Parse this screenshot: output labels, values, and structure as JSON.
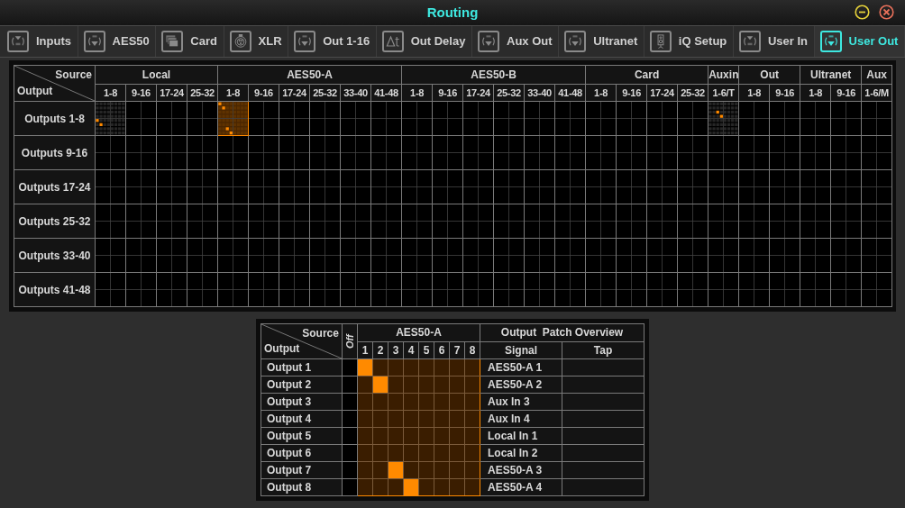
{
  "window": {
    "title": "Routing"
  },
  "tabs": [
    {
      "label": "Inputs",
      "kind": "in",
      "selected": false
    },
    {
      "label": "AES50",
      "kind": "out",
      "selected": false
    },
    {
      "label": "Card",
      "kind": "card",
      "selected": false
    },
    {
      "label": "XLR",
      "kind": "xlr",
      "selected": false
    },
    {
      "label": "Out 1-16",
      "kind": "out",
      "selected": false
    },
    {
      "label": "Out Delay",
      "kind": "delay",
      "selected": false
    },
    {
      "label": "Aux Out",
      "kind": "out",
      "selected": false
    },
    {
      "label": "Ultranet",
      "kind": "out",
      "selected": false
    },
    {
      "label": "iQ Setup",
      "kind": "speaker",
      "selected": false
    },
    {
      "label": "User In",
      "kind": "in",
      "selected": false
    },
    {
      "label": "User Out",
      "kind": "out",
      "selected": true
    }
  ],
  "overview": {
    "source_label": "Source",
    "output_label": "Output",
    "groups": [
      {
        "label": "Local",
        "blocks": [
          "1-8",
          "9-16",
          "17-24",
          "25-32"
        ]
      },
      {
        "label": "AES50-A",
        "blocks": [
          "1-8",
          "9-16",
          "17-24",
          "25-32",
          "33-40",
          "41-48"
        ]
      },
      {
        "label": "AES50-B",
        "blocks": [
          "1-8",
          "9-16",
          "17-24",
          "25-32",
          "33-40",
          "41-48"
        ]
      },
      {
        "label": "Card",
        "blocks": [
          "1-8",
          "9-16",
          "17-24",
          "25-32"
        ]
      },
      {
        "label": "Auxin",
        "blocks": [
          "1-6/T"
        ]
      },
      {
        "label": "Out",
        "blocks": [
          "1-8",
          "9-16"
        ]
      },
      {
        "label": "Ultranet",
        "blocks": [
          "1-8",
          "9-16"
        ]
      },
      {
        "label": "Aux",
        "blocks": [
          "1-6/M"
        ]
      }
    ],
    "rows": [
      {
        "label": "Outputs 1-8",
        "blocks": [
          {
            "selected": false,
            "dots": [
              [
                false,
                false,
                false,
                false,
                false,
                false,
                false,
                false
              ],
              [
                false,
                false,
                false,
                false,
                false,
                false,
                false,
                false
              ],
              [
                false,
                false,
                false,
                false,
                false,
                false,
                false,
                false
              ],
              [
                false,
                false,
                false,
                false,
                false,
                false,
                false,
                false
              ],
              [
                true,
                false,
                false,
                false,
                false,
                false,
                false,
                false
              ],
              [
                false,
                true,
                false,
                false,
                false,
                false,
                false,
                false
              ],
              [
                false,
                false,
                false,
                false,
                false,
                false,
                false,
                false
              ],
              [
                false,
                false,
                false,
                false,
                false,
                false,
                false,
                false
              ]
            ]
          },
          {
            "selected": false
          },
          {
            "selected": false
          },
          {
            "selected": false
          },
          {
            "selected": true,
            "dots": [
              [
                true,
                false,
                false,
                false,
                false,
                false,
                false,
                false
              ],
              [
                false,
                true,
                false,
                false,
                false,
                false,
                false,
                false
              ],
              [
                false,
                false,
                false,
                false,
                false,
                false,
                false,
                false
              ],
              [
                false,
                false,
                false,
                false,
                false,
                false,
                false,
                false
              ],
              [
                false,
                false,
                false,
                false,
                false,
                false,
                false,
                false
              ],
              [
                false,
                false,
                false,
                false,
                false,
                false,
                false,
                false
              ],
              [
                false,
                false,
                true,
                false,
                false,
                false,
                false,
                false
              ],
              [
                false,
                false,
                false,
                true,
                false,
                false,
                false,
                false
              ]
            ]
          },
          {
            "selected": false
          },
          {
            "selected": false
          },
          {
            "selected": false
          },
          {
            "selected": false
          },
          {
            "selected": false
          },
          {
            "selected": false
          },
          {
            "selected": false
          },
          {
            "selected": false
          },
          {
            "selected": false
          },
          {
            "selected": false
          },
          {
            "selected": false
          },
          {
            "selected": false
          },
          {
            "selected": false
          },
          {
            "selected": false
          },
          {
            "selected": false
          },
          {
            "selected": false,
            "dots": [
              [
                false,
                false,
                false,
                false,
                false,
                false,
                false,
                false
              ],
              [
                false,
                false,
                false,
                false,
                false,
                false,
                false,
                false
              ],
              [
                false,
                false,
                true,
                false,
                false,
                false,
                false,
                false
              ],
              [
                false,
                false,
                false,
                true,
                false,
                false,
                false,
                false
              ],
              [
                false,
                false,
                false,
                false,
                false,
                false,
                false,
                false
              ],
              [
                false,
                false,
                false,
                false,
                false,
                false,
                false,
                false
              ],
              [
                false,
                false,
                false,
                false,
                false,
                false,
                false,
                false
              ],
              [
                false,
                false,
                false,
                false,
                false,
                false,
                false,
                false
              ]
            ]
          },
          {
            "selected": false
          },
          {
            "selected": false
          },
          {
            "selected": false
          },
          {
            "selected": false
          },
          {
            "selected": false
          }
        ]
      },
      {
        "label": "Outputs 9-16",
        "blocks": [
          {
            "selected": false
          },
          {
            "selected": false
          },
          {
            "selected": false
          },
          {
            "selected": false
          },
          {
            "selected": false
          },
          {
            "selected": false
          },
          {
            "selected": false
          },
          {
            "selected": false
          },
          {
            "selected": false
          },
          {
            "selected": false
          },
          {
            "selected": false
          },
          {
            "selected": false
          },
          {
            "selected": false
          },
          {
            "selected": false
          },
          {
            "selected": false
          },
          {
            "selected": false
          },
          {
            "selected": false
          },
          {
            "selected": false
          },
          {
            "selected": false
          },
          {
            "selected": false
          },
          {
            "selected": false
          },
          {
            "selected": false
          },
          {
            "selected": false
          },
          {
            "selected": false
          },
          {
            "selected": false
          },
          {
            "selected": false
          }
        ]
      },
      {
        "label": "Outputs 17-24",
        "blocks": [
          {
            "selected": false
          },
          {
            "selected": false
          },
          {
            "selected": false
          },
          {
            "selected": false
          },
          {
            "selected": false
          },
          {
            "selected": false
          },
          {
            "selected": false
          },
          {
            "selected": false
          },
          {
            "selected": false
          },
          {
            "selected": false
          },
          {
            "selected": false
          },
          {
            "selected": false
          },
          {
            "selected": false
          },
          {
            "selected": false
          },
          {
            "selected": false
          },
          {
            "selected": false
          },
          {
            "selected": false
          },
          {
            "selected": false
          },
          {
            "selected": false
          },
          {
            "selected": false
          },
          {
            "selected": false
          },
          {
            "selected": false
          },
          {
            "selected": false
          },
          {
            "selected": false
          },
          {
            "selected": false
          },
          {
            "selected": false
          }
        ]
      },
      {
        "label": "Outputs 25-32",
        "blocks": [
          {
            "selected": false
          },
          {
            "selected": false
          },
          {
            "selected": false
          },
          {
            "selected": false
          },
          {
            "selected": false
          },
          {
            "selected": false
          },
          {
            "selected": false
          },
          {
            "selected": false
          },
          {
            "selected": false
          },
          {
            "selected": false
          },
          {
            "selected": false
          },
          {
            "selected": false
          },
          {
            "selected": false
          },
          {
            "selected": false
          },
          {
            "selected": false
          },
          {
            "selected": false
          },
          {
            "selected": false
          },
          {
            "selected": false
          },
          {
            "selected": false
          },
          {
            "selected": false
          },
          {
            "selected": false
          },
          {
            "selected": false
          },
          {
            "selected": false
          },
          {
            "selected": false
          },
          {
            "selected": false
          },
          {
            "selected": false
          }
        ]
      },
      {
        "label": "Outputs 33-40",
        "blocks": [
          {
            "selected": false
          },
          {
            "selected": false
          },
          {
            "selected": false
          },
          {
            "selected": false
          },
          {
            "selected": false
          },
          {
            "selected": false
          },
          {
            "selected": false
          },
          {
            "selected": false
          },
          {
            "selected": false
          },
          {
            "selected": false
          },
          {
            "selected": false
          },
          {
            "selected": false
          },
          {
            "selected": false
          },
          {
            "selected": false
          },
          {
            "selected": false
          },
          {
            "selected": false
          },
          {
            "selected": false
          },
          {
            "selected": false
          },
          {
            "selected": false
          },
          {
            "selected": false
          },
          {
            "selected": false
          },
          {
            "selected": false
          },
          {
            "selected": false
          },
          {
            "selected": false
          },
          {
            "selected": false
          },
          {
            "selected": false
          }
        ]
      },
      {
        "label": "Outputs 41-48",
        "blocks": [
          {
            "selected": false
          },
          {
            "selected": false
          },
          {
            "selected": false
          },
          {
            "selected": false
          },
          {
            "selected": false
          },
          {
            "selected": false
          },
          {
            "selected": false
          },
          {
            "selected": false
          },
          {
            "selected": false
          },
          {
            "selected": false
          },
          {
            "selected": false
          },
          {
            "selected": false
          },
          {
            "selected": false
          },
          {
            "selected": false
          },
          {
            "selected": false
          },
          {
            "selected": false
          },
          {
            "selected": false
          },
          {
            "selected": false
          },
          {
            "selected": false
          },
          {
            "selected": false
          },
          {
            "selected": false
          },
          {
            "selected": false
          },
          {
            "selected": false
          },
          {
            "selected": false
          },
          {
            "selected": false
          },
          {
            "selected": false
          }
        ]
      }
    ]
  },
  "detail": {
    "source_label": "Source",
    "output_label": "Output",
    "off_label": "Off",
    "group": "AES50-A",
    "channels": [
      "1",
      "2",
      "3",
      "4",
      "5",
      "6",
      "7",
      "8"
    ],
    "overview_title": "Output  Patch Overview",
    "signal_heading": "Signal",
    "tap_heading": "Tap",
    "rows": [
      {
        "label": "Output 1",
        "off": false,
        "cells": [
          true,
          false,
          false,
          false,
          false,
          false,
          false,
          false
        ],
        "signal": "AES50-A 1"
      },
      {
        "label": "Output 2",
        "off": false,
        "cells": [
          false,
          true,
          false,
          false,
          false,
          false,
          false,
          false
        ],
        "signal": "AES50-A 2"
      },
      {
        "label": "Output 3",
        "off": false,
        "cells": [
          false,
          false,
          false,
          false,
          false,
          false,
          false,
          false
        ],
        "signal": "Aux In 3"
      },
      {
        "label": "Output 4",
        "off": false,
        "cells": [
          false,
          false,
          false,
          false,
          false,
          false,
          false,
          false
        ],
        "signal": "Aux In 4"
      },
      {
        "label": "Output 5",
        "off": false,
        "cells": [
          false,
          false,
          false,
          false,
          false,
          false,
          false,
          false
        ],
        "signal": "Local In 1"
      },
      {
        "label": "Output 6",
        "off": false,
        "cells": [
          false,
          false,
          false,
          false,
          false,
          false,
          false,
          false
        ],
        "signal": "Local In 2"
      },
      {
        "label": "Output 7",
        "off": false,
        "cells": [
          false,
          false,
          true,
          false,
          false,
          false,
          false,
          false
        ],
        "signal": "AES50-A 3"
      },
      {
        "label": "Output 8",
        "off": false,
        "cells": [
          false,
          false,
          false,
          true,
          false,
          false,
          false,
          false
        ],
        "signal": "AES50-A 4"
      }
    ]
  }
}
